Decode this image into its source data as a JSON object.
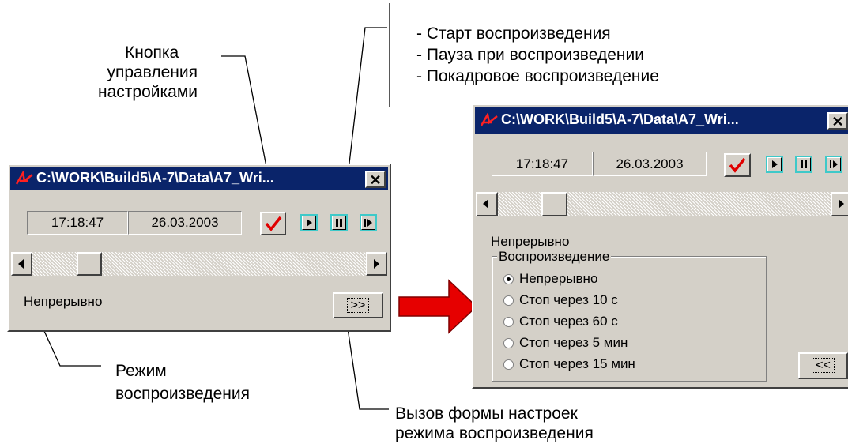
{
  "callouts": {
    "settings_button_label": [
      "Кнопка",
      "управления",
      "настройками"
    ],
    "playback_controls": [
      "- Старт воспроизведения",
      "- Пауза при воспроизведении",
      "- Покадровое воспроизведение"
    ],
    "playback_mode": [
      "Режим",
      "воспроизведения"
    ],
    "settings_form": [
      "Вызов формы настроек",
      "режима воспроизведения"
    ]
  },
  "window_small": {
    "title": "C:\\WORK\\Build5\\A-7\\Data\\A7_Wri...",
    "close_label": "✕",
    "time": "17:18:47",
    "date": "26.03.2003",
    "mode": "Непрерывно",
    "expand_label": ">>"
  },
  "window_large": {
    "title": "C:\\WORK\\Build5\\A-7\\Data\\A7_Wri...",
    "close_label": "✕",
    "time": "17:18:47",
    "date": "26.03.2003",
    "mode": "Непрерывно",
    "group_title": "Воспроизведение",
    "options": [
      "Непрерывно",
      "Стоп через 10 с",
      "Стоп через 60 с",
      "Стоп через 5 мин",
      "Стоп через 15 мин"
    ],
    "selected_option": 0,
    "collapse_label": "<<"
  },
  "colors": {
    "titlebar": "#0a246a",
    "checkmark": "#e00000",
    "arrow": "#e60000",
    "brace": "#e00000",
    "button_outline": "#3ec9c9"
  },
  "icons": [
    "app-logo-icon",
    "check-icon",
    "play-icon",
    "pause-icon",
    "step-icon",
    "scroll-left-icon",
    "scroll-right-icon",
    "close-icon",
    "big-arrow-icon"
  ]
}
